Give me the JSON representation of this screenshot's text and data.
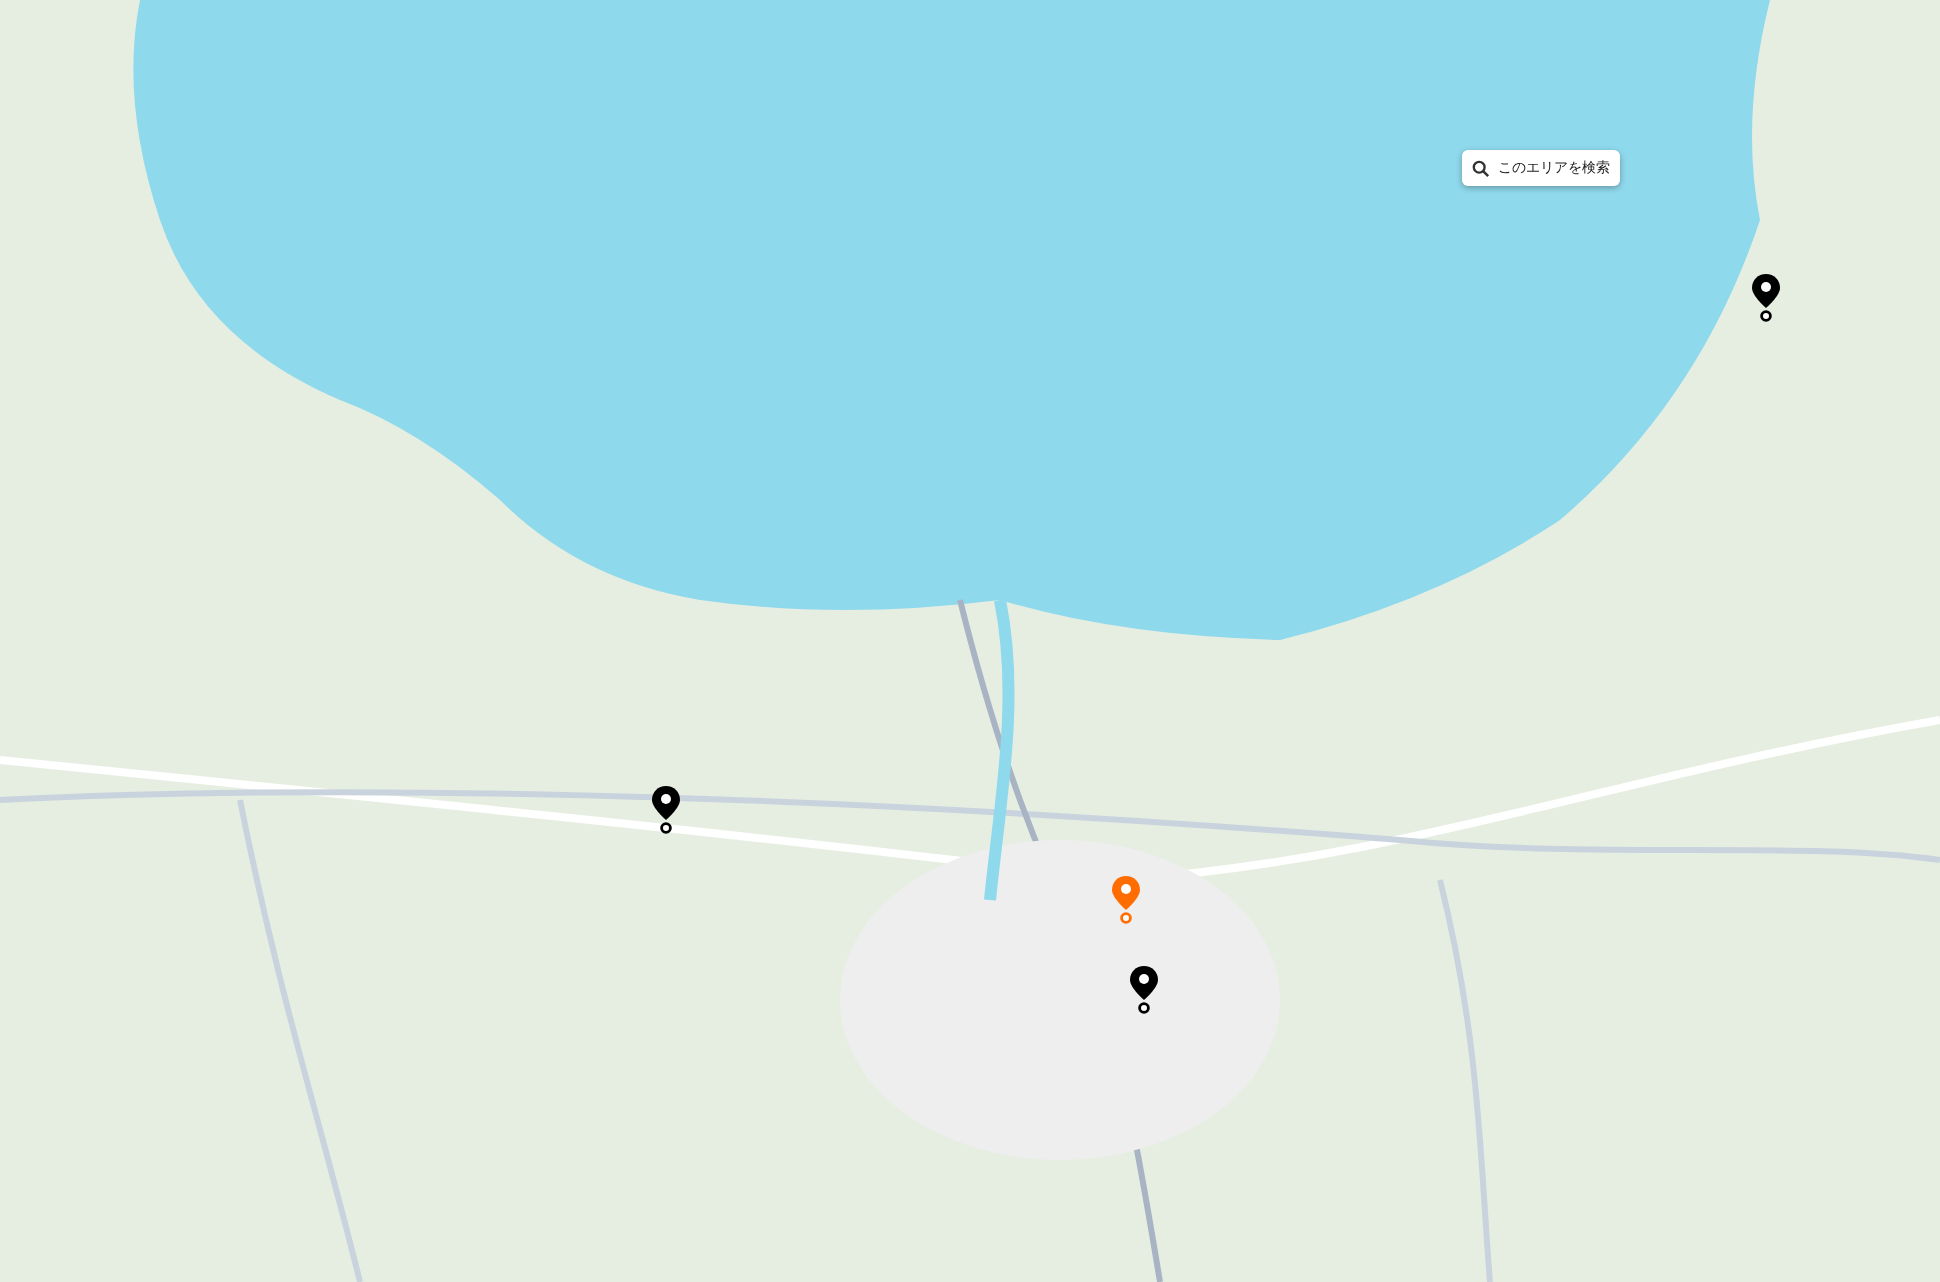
{
  "search_area_button": {
    "label": "このエリアを検索"
  },
  "markers": [
    {
      "color": "#000000"
    },
    {
      "color": "#000000"
    },
    {
      "color": "#ff6d00"
    },
    {
      "color": "#000000"
    }
  ]
}
